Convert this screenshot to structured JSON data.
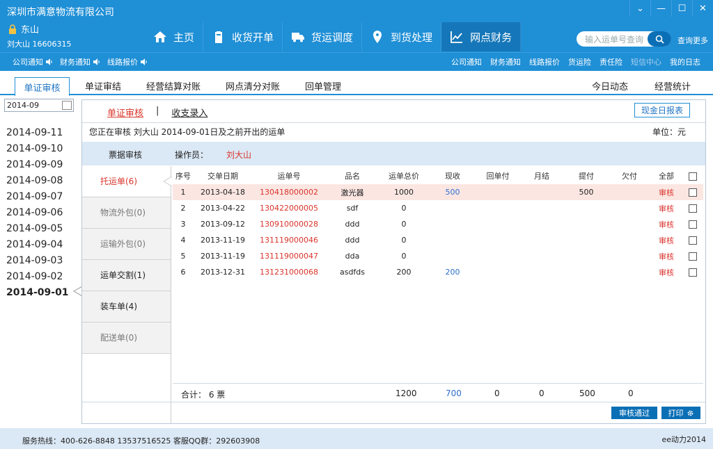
{
  "header": {
    "company": "深圳市满意物流有限公司",
    "branch": "东山",
    "user": "刘大山 16606315",
    "nav": [
      "主页",
      "收货开单",
      "货运调度",
      "到货处理",
      "网点财务"
    ],
    "search_placeholder": "输入运单号查询",
    "search_more": "查询更多",
    "notices_left": [
      "公司通知",
      "财务通知",
      "线路报价"
    ],
    "notices_right": [
      "公司通知",
      "财务通知",
      "线路报价",
      "货运险",
      "责任险",
      "短信中心",
      "我的日志"
    ]
  },
  "tabs": [
    "单证审核",
    "单证审结",
    "经营结算对账",
    "网点清分对账",
    "回单管理",
    "今日动态",
    "经营统计"
  ],
  "left": {
    "month": "2014-09",
    "dates": [
      "2014-09-11",
      "2014-09-10",
      "2014-09-09",
      "2014-09-08",
      "2014-09-07",
      "2014-09-06",
      "2014-09-05",
      "2014-09-04",
      "2014-09-03",
      "2014-09-02",
      "2014-09-01"
    ]
  },
  "panel": {
    "subtabs": [
      "单证审核",
      "收支录入"
    ],
    "separator": "|",
    "cash_report": "现金日报表",
    "audit_msg": "您正在审核 刘大山 2014-09-01日及之前开出的运单",
    "unit": "单位：元",
    "op_label": "票据审核",
    "op_prefix": "操作员：",
    "op_name": "刘大山",
    "categories": [
      "托运单(6)",
      "物流外包(0)",
      "运输外包(0)",
      "运单交割(1)",
      "装车单(4)",
      "配送单(0)"
    ],
    "columns": [
      "序号",
      "交单日期",
      "运单号",
      "品名",
      "运单总价",
      "现收",
      "回单付",
      "月结",
      "提付",
      "欠付",
      "全部"
    ],
    "rows": [
      {
        "no": "1",
        "date": "2013-04-18",
        "waybill": "130418000002",
        "item": "激光器",
        "total": "1000",
        "cash": "500",
        "ret": "",
        "monthly": "",
        "pickup": "500",
        "owe": "",
        "action": "审核"
      },
      {
        "no": "2",
        "date": "2013-04-22",
        "waybill": "130422000005",
        "item": "sdf",
        "total": "0",
        "cash": "",
        "ret": "",
        "monthly": "",
        "pickup": "",
        "owe": "",
        "action": "审核"
      },
      {
        "no": "3",
        "date": "2013-09-12",
        "waybill": "130910000028",
        "item": "ddd",
        "total": "0",
        "cash": "",
        "ret": "",
        "monthly": "",
        "pickup": "",
        "owe": "",
        "action": "审核"
      },
      {
        "no": "4",
        "date": "2013-11-19",
        "waybill": "131119000046",
        "item": "ddd",
        "total": "0",
        "cash": "",
        "ret": "",
        "monthly": "",
        "pickup": "",
        "owe": "",
        "action": "审核"
      },
      {
        "no": "5",
        "date": "2013-11-19",
        "waybill": "131119000047",
        "item": "dda",
        "total": "0",
        "cash": "",
        "ret": "",
        "monthly": "",
        "pickup": "",
        "owe": "",
        "action": "审核"
      },
      {
        "no": "6",
        "date": "2013-12-31",
        "waybill": "131231000068",
        "item": "asdfds",
        "total": "200",
        "cash": "200",
        "ret": "",
        "monthly": "",
        "pickup": "",
        "owe": "",
        "action": "审核"
      }
    ],
    "totals": {
      "label": "合计： 6 票",
      "total": "1200",
      "cash": "700",
      "ret": "0",
      "monthly": "0",
      "pickup": "500",
      "owe": "0"
    },
    "approve": "审核通过",
    "print": "打印"
  },
  "footer": {
    "hotline": "服务热线：400-626-8848  13537516525   客服QQ群：292603908",
    "brand": "ee动力2014"
  }
}
